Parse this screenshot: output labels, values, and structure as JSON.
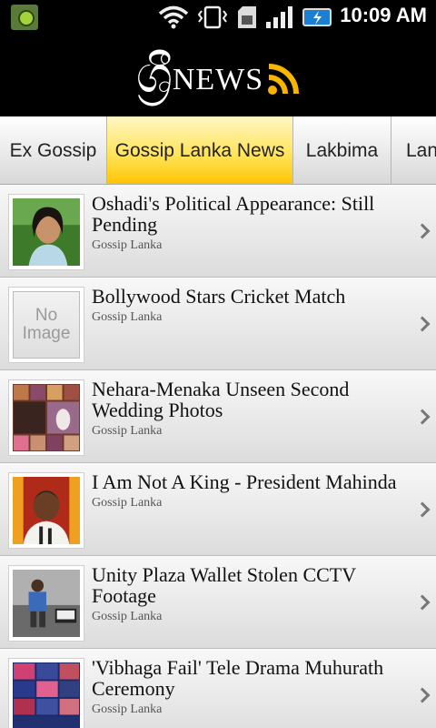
{
  "status_bar": {
    "time": "10:09 AM"
  },
  "header": {
    "logo_glyph": "ශ්‍රී",
    "logo_text": "NEWS"
  },
  "tabs": [
    {
      "label": "Ex Gossip",
      "active": false
    },
    {
      "label": "Gossip Lanka News",
      "active": true
    },
    {
      "label": "Lakbima",
      "active": false
    },
    {
      "label": "Lan",
      "active": false
    }
  ],
  "articles": [
    {
      "title": "Oshadi's Political Appearance: Still Pending",
      "source": "Gossip Lanka",
      "thumb": "portrait-woman"
    },
    {
      "title": "Bollywood Stars Cricket Match",
      "source": "Gossip Lanka",
      "thumb": "no-image",
      "thumb_text": "No Image"
    },
    {
      "title": "Nehara-Menaka Unseen Second Wedding Photos",
      "source": "Gossip Lanka",
      "thumb": "wedding-collage"
    },
    {
      "title": "I Am Not A King - President Mahinda",
      "source": "Gossip Lanka",
      "thumb": "president"
    },
    {
      "title": "Unity Plaza Wallet Stolen CCTV Footage",
      "source": "Gossip Lanka",
      "thumb": "cctv"
    },
    {
      "title": "'Vibhaga Fail' Tele Drama Muhurath Ceremony",
      "source": "Gossip Lanka",
      "thumb": "ceremony-collage"
    }
  ]
}
